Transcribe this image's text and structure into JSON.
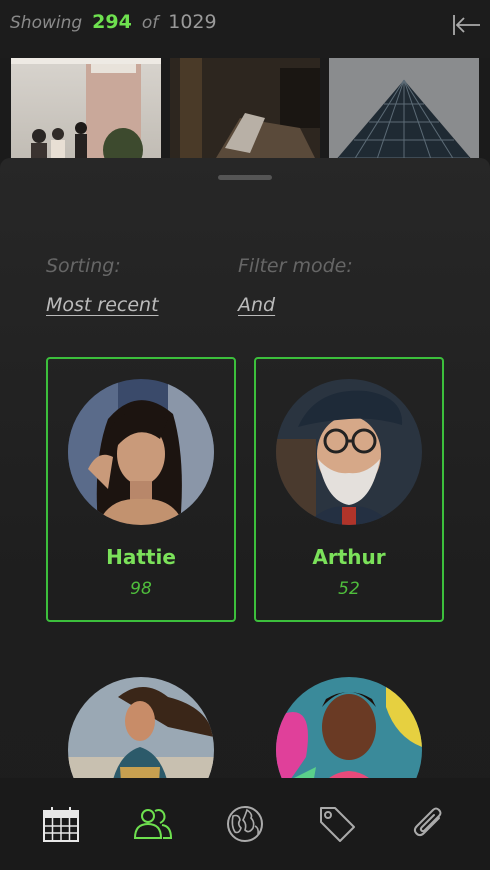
{
  "header": {
    "showing_label": "Showing",
    "shown_count": "294",
    "of_label": "of",
    "total_count": "1029"
  },
  "sheet": {
    "sorting_label": "Sorting:",
    "sorting_value": "Most recent",
    "filter_label": "Filter mode:",
    "filter_value": "And"
  },
  "people": [
    {
      "name": "Hattie",
      "count": "98"
    },
    {
      "name": "Arthur",
      "count": "52"
    }
  ],
  "colors": {
    "accent": "#6ee04f",
    "card_border": "#3cbf3c",
    "background": "#1b1b1b"
  },
  "tabbar": {
    "items": [
      "calendar-icon",
      "people-icon",
      "globe-icon",
      "tag-icon",
      "paperclip-icon"
    ],
    "active": "people-icon"
  }
}
